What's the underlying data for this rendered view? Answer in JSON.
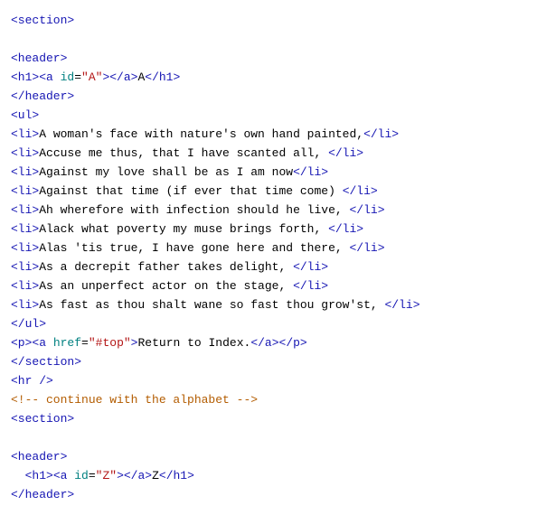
{
  "lines": [
    {
      "tokens": [
        {
          "t": "tag",
          "v": "<section>"
        }
      ]
    },
    {
      "tokens": []
    },
    {
      "tokens": [
        {
          "t": "tag",
          "v": "<header>"
        }
      ]
    },
    {
      "tokens": [
        {
          "t": "tag",
          "v": "<h1><a"
        },
        {
          "t": "text",
          "v": " "
        },
        {
          "t": "attr-name",
          "v": "id"
        },
        {
          "t": "attr-eq",
          "v": "="
        },
        {
          "t": "attr-val",
          "v": "\"A\""
        },
        {
          "t": "tag",
          "v": "></a>"
        },
        {
          "t": "text",
          "v": "A"
        },
        {
          "t": "tag",
          "v": "</h1>"
        }
      ]
    },
    {
      "tokens": [
        {
          "t": "tag",
          "v": "</header>"
        }
      ]
    },
    {
      "tokens": [
        {
          "t": "tag",
          "v": "<ul>"
        }
      ]
    },
    {
      "tokens": [
        {
          "t": "tag",
          "v": "<li>"
        },
        {
          "t": "text",
          "v": "A woman's face with nature's own hand painted,"
        },
        {
          "t": "tag",
          "v": "</li>"
        }
      ]
    },
    {
      "tokens": [
        {
          "t": "tag",
          "v": "<li>"
        },
        {
          "t": "text",
          "v": "Accuse me thus, that I have scanted all, "
        },
        {
          "t": "tag",
          "v": "</li>"
        }
      ]
    },
    {
      "tokens": [
        {
          "t": "tag",
          "v": "<li>"
        },
        {
          "t": "text",
          "v": "Against my love shall be as I am now"
        },
        {
          "t": "tag",
          "v": "</li>"
        }
      ]
    },
    {
      "tokens": [
        {
          "t": "tag",
          "v": "<li>"
        },
        {
          "t": "text",
          "v": "Against that time (if ever that time come) "
        },
        {
          "t": "tag",
          "v": "</li>"
        }
      ]
    },
    {
      "tokens": [
        {
          "t": "tag",
          "v": "<li>"
        },
        {
          "t": "text",
          "v": "Ah wherefore with infection should he live, "
        },
        {
          "t": "tag",
          "v": "</li>"
        }
      ]
    },
    {
      "tokens": [
        {
          "t": "tag",
          "v": "<li>"
        },
        {
          "t": "text",
          "v": "Alack what poverty my muse brings forth, "
        },
        {
          "t": "tag",
          "v": "</li>"
        }
      ]
    },
    {
      "tokens": [
        {
          "t": "tag",
          "v": "<li>"
        },
        {
          "t": "text",
          "v": "Alas 'tis true, I have gone here and there, "
        },
        {
          "t": "tag",
          "v": "</li>"
        }
      ]
    },
    {
      "tokens": [
        {
          "t": "tag",
          "v": "<li>"
        },
        {
          "t": "text",
          "v": "As a decrepit father takes delight, "
        },
        {
          "t": "tag",
          "v": "</li>"
        }
      ]
    },
    {
      "tokens": [
        {
          "t": "tag",
          "v": "<li>"
        },
        {
          "t": "text",
          "v": "As an unperfect actor on the stage, "
        },
        {
          "t": "tag",
          "v": "</li>"
        }
      ]
    },
    {
      "tokens": [
        {
          "t": "tag",
          "v": "<li>"
        },
        {
          "t": "text",
          "v": "As fast as thou shalt wane so fast thou grow'st, "
        },
        {
          "t": "tag",
          "v": "</li>"
        }
      ]
    },
    {
      "tokens": [
        {
          "t": "tag",
          "v": "</ul>"
        }
      ]
    },
    {
      "tokens": [
        {
          "t": "tag",
          "v": "<p><a"
        },
        {
          "t": "text",
          "v": " "
        },
        {
          "t": "attr-name",
          "v": "href"
        },
        {
          "t": "attr-eq",
          "v": "="
        },
        {
          "t": "attr-val",
          "v": "\"#top\""
        },
        {
          "t": "tag",
          "v": ">"
        },
        {
          "t": "text",
          "v": "Return to Index."
        },
        {
          "t": "tag",
          "v": "</a></p>"
        }
      ]
    },
    {
      "tokens": [
        {
          "t": "tag",
          "v": "</section>"
        }
      ]
    },
    {
      "tokens": [
        {
          "t": "tag",
          "v": "<hr />"
        }
      ]
    },
    {
      "tokens": [
        {
          "t": "comment",
          "v": "<!-- continue with the alphabet -->"
        }
      ]
    },
    {
      "tokens": [
        {
          "t": "tag",
          "v": "<section>"
        }
      ]
    },
    {
      "tokens": []
    },
    {
      "tokens": [
        {
          "t": "tag",
          "v": "<header>"
        }
      ]
    },
    {
      "tokens": [
        {
          "t": "text",
          "v": "  "
        },
        {
          "t": "tag",
          "v": "<h1><a"
        },
        {
          "t": "text",
          "v": " "
        },
        {
          "t": "attr-name",
          "v": "id"
        },
        {
          "t": "attr-eq",
          "v": "="
        },
        {
          "t": "attr-val",
          "v": "\"Z\""
        },
        {
          "t": "tag",
          "v": "></a>"
        },
        {
          "t": "text",
          "v": "Z"
        },
        {
          "t": "tag",
          "v": "</h1>"
        }
      ]
    },
    {
      "tokens": [
        {
          "t": "tag",
          "v": "</header>"
        }
      ]
    }
  ]
}
